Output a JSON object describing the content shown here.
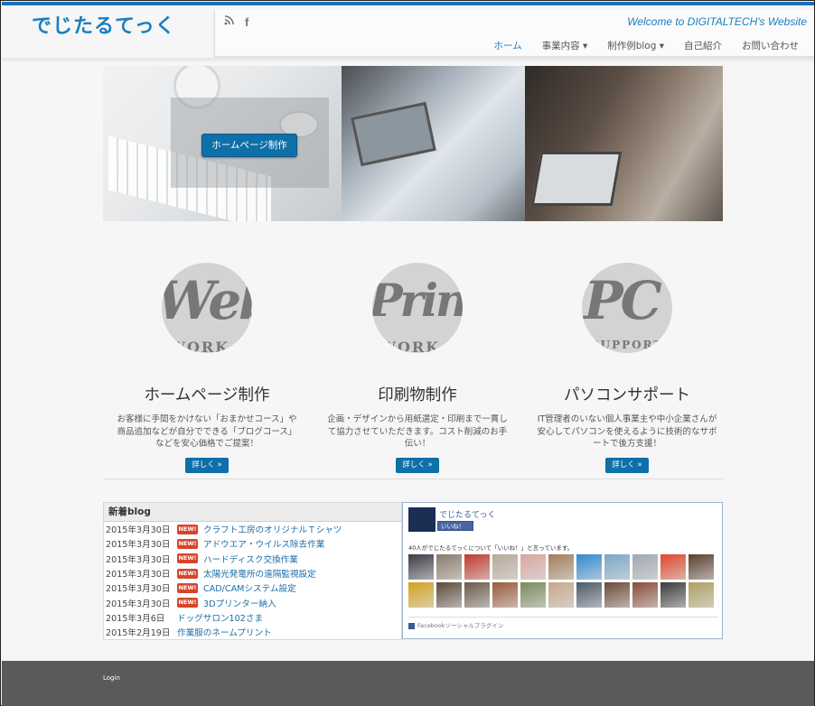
{
  "header": {
    "logo": "でじたるてっく",
    "welcome": "Welcome to DIGITALTECH's Website",
    "social_icons": [
      "rss-icon",
      "facebook-icon"
    ],
    "menu": [
      {
        "label": "ホーム",
        "active": true
      },
      {
        "label": "事業内容 ▾",
        "active": false
      },
      {
        "label": "制作例blog ▾",
        "active": false
      },
      {
        "label": "自己紹介",
        "active": false
      },
      {
        "label": "お問い合わせ",
        "active": false
      }
    ]
  },
  "hero": {
    "button_label": "ホームページ制作"
  },
  "services": [
    {
      "badge": "Web",
      "badge_sub": "WORK",
      "title": "ホームページ制作",
      "text": "お客様に手間をかけない「おまかせコース」や商品追加などが自分でできる「ブログコース」などを安心価格でご提案！",
      "button": "詳しく »"
    },
    {
      "badge": "Print",
      "badge_sub": "WORK",
      "title": "印刷物制作",
      "text": "企画・デザインから用紙選定・印刷まで一貫して協力させていただきます。コスト削減のお手伝い！",
      "button": "詳しく »"
    },
    {
      "badge": "PC",
      "badge_sub": "SUPPORT",
      "title": "パソコンサポート",
      "text": "IT管理者のいない個人事業主や中小企業さんが安心してパソコンを使えるように技術的なサポートで後方支援！",
      "button": "詳しく »"
    }
  ],
  "blog": {
    "heading": "新着blog",
    "new_label": "NEW!",
    "items": [
      {
        "date": "2015年3月30日",
        "new": true,
        "title": "クラフト工房のオリジナルＴシャツ"
      },
      {
        "date": "2015年3月30日",
        "new": true,
        "title": "アドウエア・ウイルス除去作業"
      },
      {
        "date": "2015年3月30日",
        "new": true,
        "title": "ハードディスク交換作業"
      },
      {
        "date": "2015年3月30日",
        "new": true,
        "title": "太陽光発電所の遠隔監視設定"
      },
      {
        "date": "2015年3月30日",
        "new": true,
        "title": "CAD/CAMシステム設定"
      },
      {
        "date": "2015年3月30日",
        "new": true,
        "title": "3Dプリンター納入"
      },
      {
        "date": "2015年3月6日",
        "new": false,
        "title": "ドッグサロン102さま"
      },
      {
        "date": "2015年2月19日",
        "new": false,
        "title": "作業服のネームプリント"
      }
    ]
  },
  "facebook": {
    "page_name": "でじたるてっく",
    "like_label": "いいね！",
    "count_text": "40人がでじたるてっくについて「いいね！」と言っています。",
    "footer": "Facebookソーシャルプラグイン",
    "avatar_colors": [
      "#3b3b45",
      "#8a7b6a",
      "#c0392b",
      "#b8a99a",
      "#d9a7a0",
      "#a27d5c",
      "#2f8bd0",
      "#7aa6c8",
      "#a0a8b0",
      "#e0452b",
      "#5a3f2f",
      "#d4a21c",
      "#5d4a3a",
      "#6b5a4a",
      "#9a5a3a",
      "#7b8a5a",
      "#c7a88a",
      "#4a5a6a",
      "#6a4a3a",
      "#8a4a3a",
      "#3a3a3a",
      "#b0a060"
    ]
  },
  "footer": {
    "login": "Login"
  }
}
